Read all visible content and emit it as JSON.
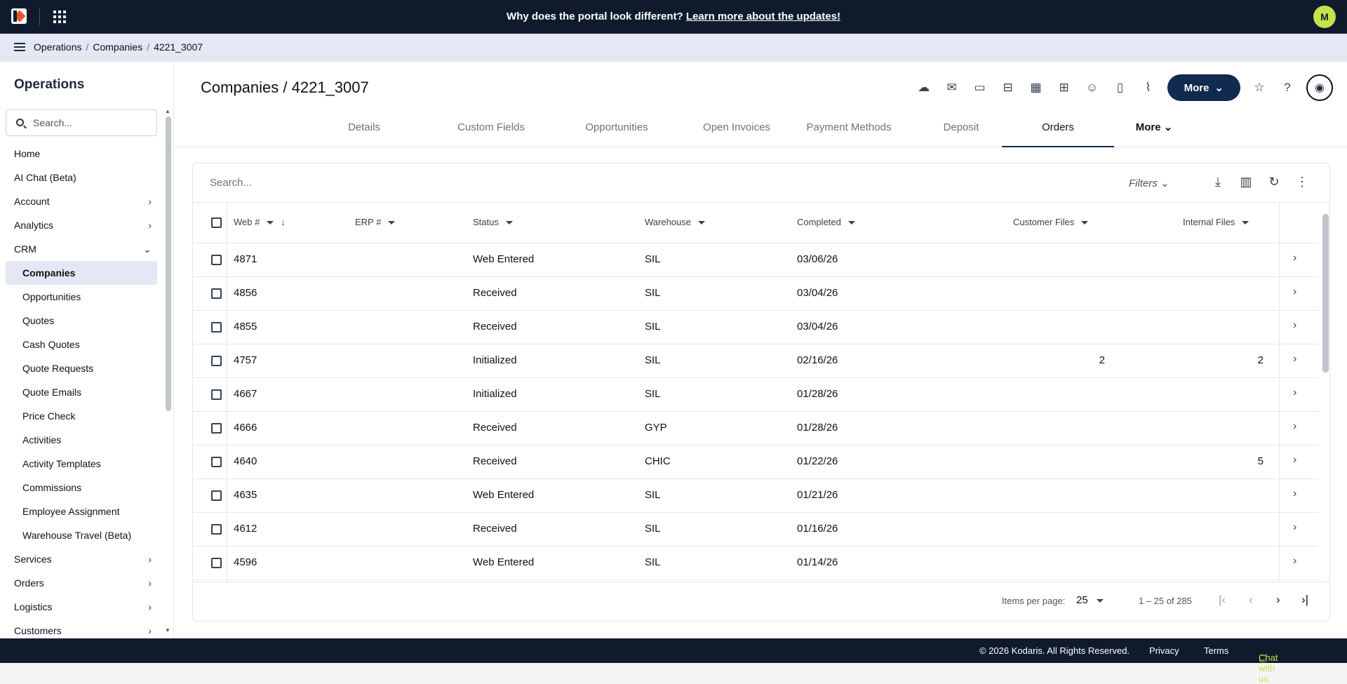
{
  "topbar": {
    "banner_text": "Why does the portal look different?",
    "banner_link": "Learn more about the updates!",
    "avatar_initial": "M"
  },
  "breadcrumb": [
    "Operations",
    "Companies",
    "4221_3007"
  ],
  "sidebar": {
    "title": "Operations",
    "search_placeholder": "Search...",
    "items": [
      {
        "label": "Home",
        "chevron": ""
      },
      {
        "label": "AI Chat (Beta)",
        "chevron": ""
      },
      {
        "label": "Account",
        "chevron": "›"
      },
      {
        "label": "Analytics",
        "chevron": "›"
      },
      {
        "label": "CRM",
        "chevron": "⌄"
      }
    ],
    "crm_children": [
      "Companies",
      "Opportunities",
      "Quotes",
      "Cash Quotes",
      "Quote Requests",
      "Quote Emails",
      "Price Check",
      "Activities",
      "Activity Templates",
      "Commissions",
      "Employee Assignment",
      "Warehouse Travel (Beta)"
    ],
    "items_after": [
      {
        "label": "Services",
        "chevron": "›"
      },
      {
        "label": "Orders",
        "chevron": "›"
      },
      {
        "label": "Logistics",
        "chevron": "›"
      },
      {
        "label": "Customers",
        "chevron": "›"
      }
    ]
  },
  "page": {
    "title": "Companies / 4221_3007",
    "more_label": "More"
  },
  "tabs": [
    "Details",
    "Custom Fields",
    "Opportunities",
    "Open Invoices",
    "Payment Methods",
    "Deposit",
    "Orders",
    "More"
  ],
  "table": {
    "search_placeholder": "Search...",
    "filters_label": "Filters",
    "columns": [
      "Web #",
      "ERP #",
      "Status",
      "Warehouse",
      "Completed",
      "Customer Files",
      "Internal Files"
    ],
    "rows": [
      {
        "web": "4871",
        "erp": "",
        "status": "Web Entered",
        "warehouse": "SIL",
        "completed": "03/06/26",
        "customer_files": "",
        "internal_files": ""
      },
      {
        "web": "4856",
        "erp": "",
        "status": "Received",
        "warehouse": "SIL",
        "completed": "03/04/26",
        "customer_files": "",
        "internal_files": ""
      },
      {
        "web": "4855",
        "erp": "",
        "status": "Received",
        "warehouse": "SIL",
        "completed": "03/04/26",
        "customer_files": "",
        "internal_files": ""
      },
      {
        "web": "4757",
        "erp": "",
        "status": "Initialized",
        "warehouse": "SIL",
        "completed": "02/16/26",
        "customer_files": "2",
        "internal_files": "2"
      },
      {
        "web": "4667",
        "erp": "",
        "status": "Initialized",
        "warehouse": "SIL",
        "completed": "01/28/26",
        "customer_files": "",
        "internal_files": ""
      },
      {
        "web": "4666",
        "erp": "",
        "status": "Received",
        "warehouse": "GYP",
        "completed": "01/28/26",
        "customer_files": "",
        "internal_files": ""
      },
      {
        "web": "4640",
        "erp": "",
        "status": "Received",
        "warehouse": "CHIC",
        "completed": "01/22/26",
        "customer_files": "",
        "internal_files": "5"
      },
      {
        "web": "4635",
        "erp": "",
        "status": "Web Entered",
        "warehouse": "SIL",
        "completed": "01/21/26",
        "customer_files": "",
        "internal_files": ""
      },
      {
        "web": "4612",
        "erp": "",
        "status": "Received",
        "warehouse": "SIL",
        "completed": "01/16/26",
        "customer_files": "",
        "internal_files": ""
      },
      {
        "web": "4596",
        "erp": "",
        "status": "Web Entered",
        "warehouse": "SIL",
        "completed": "01/14/26",
        "customer_files": "",
        "internal_files": ""
      }
    ],
    "pagination": {
      "items_per_page_label": "Items per page:",
      "items_per_page": "25",
      "range": "1 – 25 of 285"
    }
  },
  "bottombar": {
    "copyright": "© 2026 Kodaris. All Rights Reserved.",
    "privacy": "Privacy",
    "terms": "Terms",
    "chat": "Chat with us"
  },
  "colors": {
    "navy": "#0f1b2d",
    "accent": "#112a4f",
    "chat_green": "#c6e34a"
  }
}
